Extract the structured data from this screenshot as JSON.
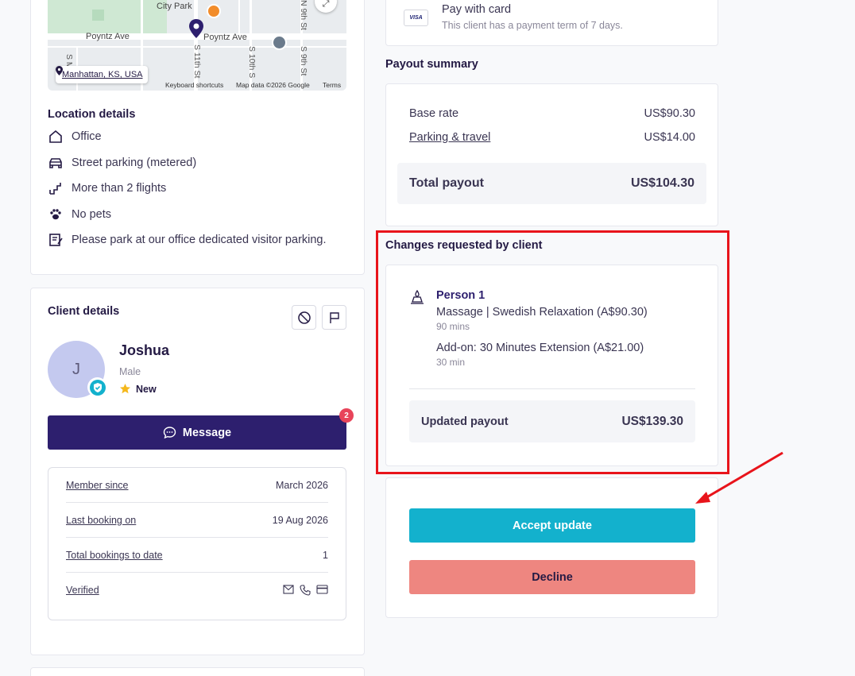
{
  "map": {
    "labels": {
      "city_park": "City Park",
      "poyntz_left": "Poyntz Ave",
      "poyntz_right": "Poyntz Ave",
      "s_ma": "S Ma",
      "s_11th": "S 11th St",
      "s_10th": "S 10th S",
      "s_9th": "S 9th St",
      "n_9th": "N 9th St"
    },
    "location_chip": "Manhattan, KS, USA",
    "footer": {
      "shortcuts": "Keyboard shortcuts",
      "data": "Map data ©2026 Google",
      "terms": "Terms"
    }
  },
  "location": {
    "title": "Location details",
    "items": [
      {
        "icon": "home-icon",
        "label": "Office"
      },
      {
        "icon": "car-icon",
        "label": "Street parking (metered)"
      },
      {
        "icon": "stairs-icon",
        "label": "More than 2 flights"
      },
      {
        "icon": "paw-icon",
        "label": "No pets"
      },
      {
        "icon": "note-icon",
        "label": "Please park at our office dedicated visitor parking."
      }
    ]
  },
  "client": {
    "title": "Client details",
    "initial": "J",
    "name": "Joshua",
    "gender": "Male",
    "status": "New",
    "message_label": "Message",
    "message_badge": "2",
    "rows": [
      {
        "label": "Member since",
        "value": "March 2026"
      },
      {
        "label": "Last booking on",
        "value": "19 Aug 2026"
      },
      {
        "label": "Total bookings to date",
        "value": "1"
      },
      {
        "label": "Verified",
        "value": ""
      }
    ]
  },
  "payment": {
    "card_brand": "VISA",
    "title": "Pay with card",
    "note": "This client has a payment term of 7 days."
  },
  "payout": {
    "title": "Payout summary",
    "rows": [
      {
        "label": "Base rate",
        "value": "US$90.30"
      },
      {
        "label": "Parking & travel",
        "value": "US$14.00"
      }
    ],
    "total_label": "Total payout",
    "total_value": "US$104.30"
  },
  "changes": {
    "title": "Changes requested by client",
    "person": "Person 1",
    "service": "Massage | Swedish Relaxation (A$90.30)",
    "service_duration": "90 mins",
    "addon": "Add-on: 30 Minutes Extension (A$21.00)",
    "addon_duration": "30 min",
    "updated_label": "Updated payout",
    "updated_value": "US$139.30"
  },
  "actions": {
    "accept": "Accept update",
    "decline": "Decline"
  },
  "colors": {
    "primary": "#2d1f6e",
    "accept": "#13b1cd",
    "decline": "#ee8680",
    "highlight": "#e8141b"
  }
}
